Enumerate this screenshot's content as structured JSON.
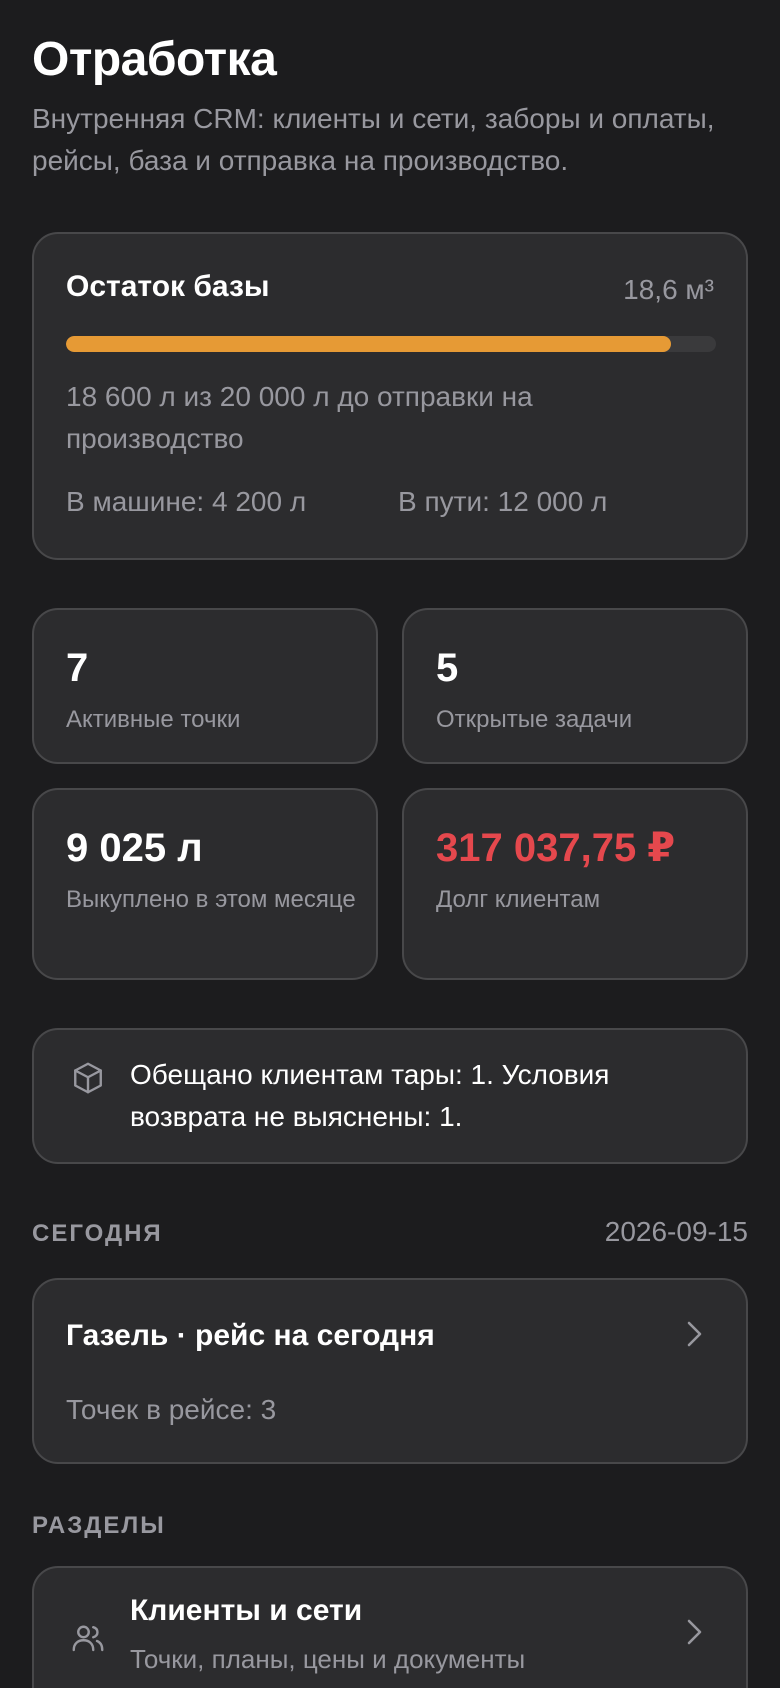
{
  "header": {
    "title": "Отработка",
    "subtitle": "Внутренняя CRM: клиенты и сети, заборы и оплаты, рейсы, база и отправка на производство."
  },
  "base": {
    "title": "Остаток базы",
    "volume": "18,6 м³",
    "progress_fraction": 0.93,
    "description": "18 600 л из 20 000 л до отправки на производство",
    "in_truck": "В машине: 4 200 л",
    "in_transit": "В пути: 12 000 л",
    "progress_color": "#e69a35"
  },
  "stats": [
    {
      "value": "7",
      "label": "Активные точки"
    },
    {
      "value": "5",
      "label": "Открытые задачи"
    },
    {
      "value": "9 025 л",
      "label": "Выкуплено в этом месяце"
    },
    {
      "value": "317 037,75 ₽",
      "label": "Долг клиентам",
      "color": "#e5484d"
    }
  ],
  "notice": {
    "icon": "box-icon",
    "text": "Обещано клиентам тары: 1. Условия возврата не выяснены: 1."
  },
  "today": {
    "header": "СЕГОДНЯ",
    "date": "2026-09-15",
    "trip_title": "Газель · рейс на сегодня",
    "trip_points": "Точек в рейсе: 3"
  },
  "sections": {
    "header": "РАЗДЕЛЫ",
    "items": [
      {
        "icon": "users-icon",
        "title": "Клиенты и сети",
        "subtitle": "Точки, планы, цены и документы"
      }
    ]
  }
}
